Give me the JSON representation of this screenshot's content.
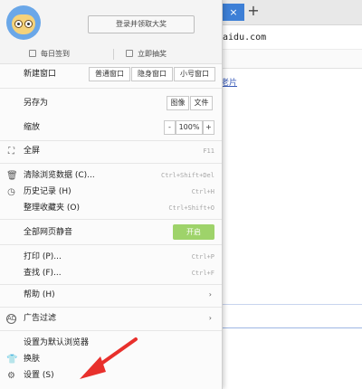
{
  "browser": {
    "tab_close": "×",
    "new_tab": "+",
    "address": "baidu.com",
    "link": "老片"
  },
  "menu": {
    "login_label": "登录并领取大奖",
    "checkin_label": "每日签到",
    "draw_label": "立即抽奖",
    "new_window": {
      "label": "新建窗口",
      "options": [
        "普通窗口",
        "隐身窗口",
        "小号窗口"
      ]
    },
    "save_as": {
      "label": "另存为",
      "options": [
        "图像",
        "文件"
      ]
    },
    "zoom": {
      "label": "缩放",
      "minus": "-",
      "value": "100%",
      "plus": "+"
    },
    "fullscreen": {
      "label": "全屏",
      "shortcut": "F11"
    },
    "clear_data": {
      "label": "清除浏览数据 (C)...",
      "shortcut": "Ctrl+Shift+Del"
    },
    "history": {
      "label": "历史记录 (H)",
      "shortcut": "Ctrl+H"
    },
    "organize_fav": {
      "label": "整理收藏夹 (O)",
      "shortcut": "Ctrl+Shift+O"
    },
    "mute": {
      "label": "全部网页静音",
      "toggle": "开启"
    },
    "print": {
      "label": "打印 (P)...",
      "shortcut": "Ctrl+P"
    },
    "find": {
      "label": "查找 (F)...",
      "shortcut": "Ctrl+F"
    },
    "help": {
      "label": "帮助 (H)",
      "chevron": "›"
    },
    "adfilter": {
      "label": "广告过滤",
      "chevron": "›"
    },
    "default_browser": {
      "label": "设置为默认浏览器"
    },
    "skin": {
      "label": "换肤"
    },
    "settings": {
      "label": "设置 (S)"
    }
  },
  "colors": {
    "tab_active": "#3d7fd6",
    "toggle_on": "#9ed36a",
    "annotation_arrow": "#e8302c"
  }
}
